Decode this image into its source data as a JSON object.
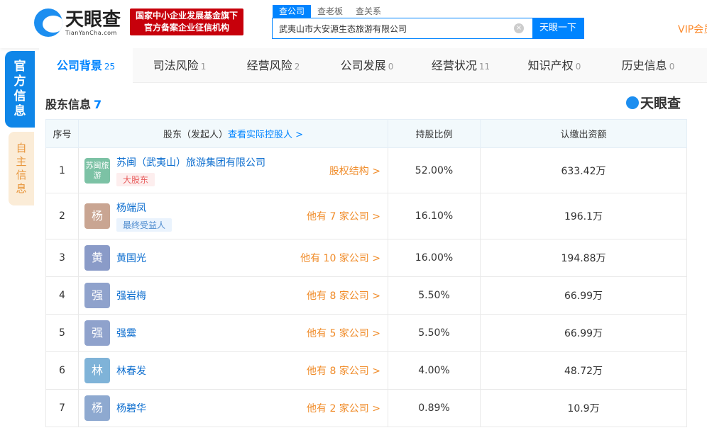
{
  "header": {
    "logo_cn": "天眼查",
    "logo_en": "TianYanCha.com",
    "badge_line1": "国家中小企业发展基金旗下",
    "badge_line2": "官方备案企业征信机构",
    "search_tabs": [
      "查公司",
      "查老板",
      "查关系"
    ],
    "search_value": "武夷山市大安源生态旅游有限公司",
    "clear_icon": "×",
    "search_button": "天眼一下",
    "vip": "VIP会员"
  },
  "side": {
    "official": "官方信息",
    "self": "自主信息"
  },
  "tabs": [
    {
      "label": "公司背景",
      "count": "25"
    },
    {
      "label": "司法风险",
      "count": "1"
    },
    {
      "label": "经营风险",
      "count": "2"
    },
    {
      "label": "公司发展",
      "count": "0"
    },
    {
      "label": "经营状况",
      "count": "11"
    },
    {
      "label": "知识产权",
      "count": "0"
    },
    {
      "label": "历史信息",
      "count": "0"
    }
  ],
  "section": {
    "title": "股东信息",
    "count": "7",
    "watermark": "天眼查"
  },
  "table": {
    "headers": {
      "no": "序号",
      "holder": "股东（发起人）",
      "holder_link": "查看实际控股人 >",
      "ratio": "持股比例",
      "capital": "认缴出资额"
    },
    "rows": [
      {
        "no": "1",
        "avatar": "苏闽旅游",
        "avatar_color": "#7cc2a5",
        "name": "苏闽（武夷山）旅游集团有限公司",
        "tag": "大股东",
        "tag_type": "r",
        "link": "股权结构 >",
        "ratio": "52.00%",
        "capital": "633.42万"
      },
      {
        "no": "2",
        "avatar": "杨",
        "avatar_color": "#c9a592",
        "name": "杨端凤",
        "tag": "最终受益人",
        "tag_type": "b",
        "link": "他有 7 家公司 >",
        "ratio": "16.10%",
        "capital": "196.1万"
      },
      {
        "no": "3",
        "avatar": "黄",
        "avatar_color": "#8a9bc8",
        "name": "黄国光",
        "tag": "",
        "link": "他有 10 家公司 >",
        "ratio": "16.00%",
        "capital": "194.88万"
      },
      {
        "no": "4",
        "avatar": "强",
        "avatar_color": "#8fa2cc",
        "name": "强岩梅",
        "tag": "",
        "link": "他有 8 家公司 >",
        "ratio": "5.50%",
        "capital": "66.99万"
      },
      {
        "no": "5",
        "avatar": "强",
        "avatar_color": "#8fa2cc",
        "name": "强霙",
        "tag": "",
        "link": "他有 5 家公司 >",
        "ratio": "5.50%",
        "capital": "66.99万"
      },
      {
        "no": "6",
        "avatar": "林",
        "avatar_color": "#7fb3d8",
        "name": "林春发",
        "tag": "",
        "link": "他有 8 家公司 >",
        "ratio": "4.00%",
        "capital": "48.72万"
      },
      {
        "no": "7",
        "avatar": "杨",
        "avatar_color": "#8ea9d0",
        "name": "杨碧华",
        "tag": "",
        "link": "他有 2 家公司 >",
        "ratio": "0.89%",
        "capital": "10.9万"
      }
    ]
  }
}
